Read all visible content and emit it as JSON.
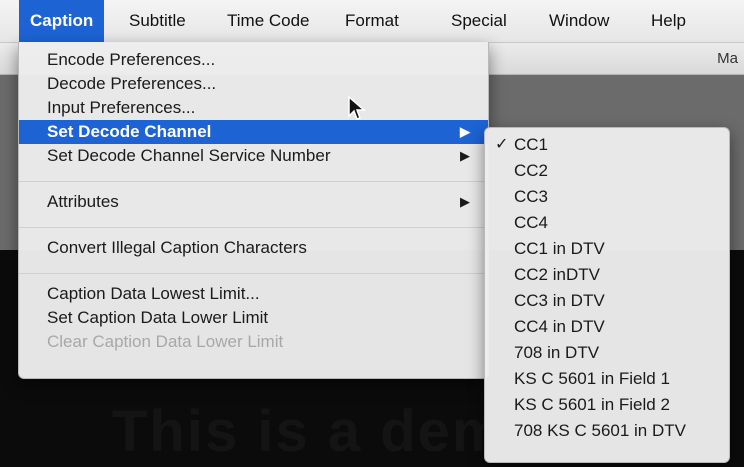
{
  "menubar": {
    "items": [
      "Caption",
      "Subtitle",
      "Time Code",
      "Format",
      "Special",
      "Window",
      "Help"
    ]
  },
  "background": {
    "toolbar_text": "Ma",
    "caption_preview": "This is a dem"
  },
  "caption_menu": {
    "items": [
      "Encode Preferences...",
      "Decode Preferences...",
      "Input Preferences...",
      "Set Decode Channel",
      "Set Decode Channel Service Number",
      "Attributes",
      "Convert Illegal Caption Characters",
      "Caption Data Lowest Limit...",
      "Set Caption Data Lower Limit",
      "Clear Caption Data Lower Limit"
    ],
    "submenu_arrow": "▶"
  },
  "channel_submenu": {
    "checkmark": "✓",
    "items": [
      "CC1",
      "CC2",
      "CC3",
      "CC4",
      "CC1 in DTV",
      "CC2 inDTV",
      "CC3 in DTV",
      "CC4 in DTV",
      "708 in DTV",
      "KS C 5601 in Field 1",
      "KS C 5601 in Field 2",
      "708 KS C 5601 in DTV"
    ]
  },
  "colors": {
    "highlight": "#1d63d4",
    "menu_bg": "#ececec",
    "disabled_text": "#a8a8a8"
  }
}
